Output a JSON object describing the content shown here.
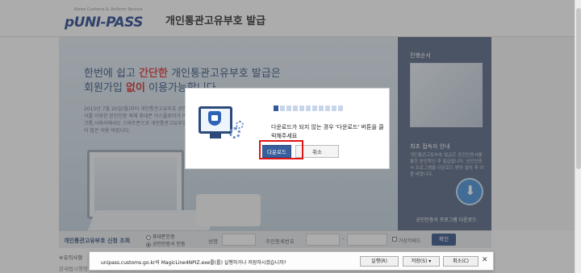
{
  "header": {
    "logo_text": "pUNI-PASS",
    "logo_sub": "Korea Customs & Uniform Service",
    "title": "개인통관고유부호 발급"
  },
  "hero": {
    "line1_pre": "한번에 쉽고 ",
    "line1_hl": "간단한",
    "line1_post": " 개인통관고유부호 발급은",
    "line2_pre": "회원가입 ",
    "line2_hl": "없이",
    "line2_post": " 이용가능합니다",
    "desc": "2015년 7월 20일(월)부터 개인통관고유부호 공인인증서를 이용한 본인인증 외에 휴대폰 익스플로러가 아닌 크롬,사파리에서도 스마트폰으로 개인통관고유부호발급이 많은 이용 바랍니다."
  },
  "right_col": {
    "title1": "진행순서",
    "title2": "최초 접속자 안내",
    "text2": "개인통관고유부호 발급은 공인인증서를 통한 본인확인 후 발급됩니다. 공인인증서 프로그램을 다운로드 받아 설치 후 이용 바랍니다.",
    "download_label": "공인인증서 프로그램 다운로드"
  },
  "searchbar": {
    "label": "개인통관고유부호 신청 조회",
    "radio1": "휴대폰인증",
    "radio2": "공인인증서 인증",
    "name_label": "성명",
    "rrn_label": "주민등록번호",
    "dash": "-",
    "vk_label": "가상키패드",
    "submit": "확인"
  },
  "notices": {
    "line1": "※유의사항",
    "line2": "관세법시행령"
  },
  "modal": {
    "progress_total": 11,
    "progress_done": 1,
    "message": "다운로드가 되지 않는 경우 '다운로드' 버튼을 클릭해주세요",
    "download_button": "다운로드",
    "cancel_button": "취소"
  },
  "download_bar": {
    "message": "unipass.customs.go.kr의 MagicLine4NPIZ.exe를(를) 실행하거나 저장하시겠습니까?",
    "run": "실행(R)",
    "save": "저장(S) ▾",
    "cancel": "취소(C)",
    "close": "✕"
  },
  "colors": {
    "brand_navy": "#2c4c83",
    "highlight_red": "#e01515",
    "right_panel": "#4f5f7c"
  }
}
